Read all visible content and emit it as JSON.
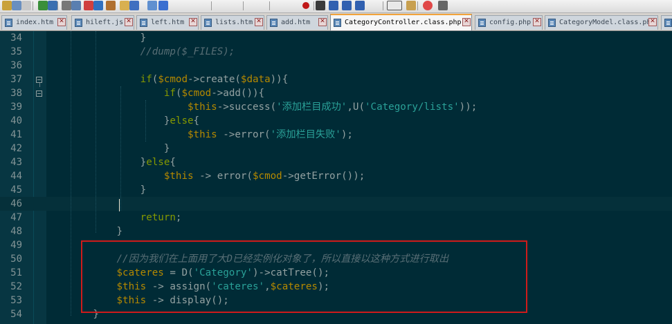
{
  "colors": {
    "background": "#002b36",
    "gutter": "#073642",
    "keyword": "#859900",
    "variable": "#b58900",
    "string": "#2aa198",
    "comment": "#586e75",
    "plain": "#93a1a1",
    "annotation_box": "#d01b1b",
    "active_tab_accent": "#f2a23a"
  },
  "toolbar": {
    "icons": [
      "cut-icon",
      "copy-icon",
      "paste-icon",
      "undo-icon",
      "redo-icon",
      "print-icon",
      "find-icon",
      "zoom-in-icon",
      "zoom-out-icon",
      "sync-icon",
      "new-file-icon",
      "wrap-icon",
      "indent-guide-icon",
      "show-all-icon",
      "record-macro-icon",
      "stop-macro-icon",
      "play-macro-icon",
      "run-macro-icon",
      "save-macro-icon",
      "ds-icon",
      "bookmark-icon",
      "heart-icon",
      "monitor-icon"
    ]
  },
  "tabs": [
    {
      "label": "index.htm",
      "close": "✕"
    },
    {
      "label": "hileft.js",
      "close": "✕"
    },
    {
      "label": "left.htm",
      "close": "✕"
    },
    {
      "label": "lists.htm",
      "close": "✕"
    },
    {
      "label": "add.htm",
      "close": "✕"
    },
    {
      "label": "CategoryController.class.php",
      "close": "✕",
      "active": true
    },
    {
      "label": "config.php",
      "close": "✕"
    },
    {
      "label": "CategoryModel.class.php",
      "close": "✕"
    }
  ],
  "editor": {
    "current_line": 46,
    "lines": [
      {
        "num": "34",
        "tokens": [
          {
            "t": "                }",
            "c": "plain"
          }
        ]
      },
      {
        "num": "35",
        "tokens": [
          {
            "t": "                //dump($_FILES);",
            "c": "cm"
          }
        ]
      },
      {
        "num": "36",
        "tokens": []
      },
      {
        "num": "37",
        "tokens": [
          {
            "t": "                ",
            "c": "plain"
          },
          {
            "t": "if",
            "c": "kw"
          },
          {
            "t": "(",
            "c": "plain"
          },
          {
            "t": "$cmod",
            "c": "var"
          },
          {
            "t": "->create(",
            "c": "plain"
          },
          {
            "t": "$data",
            "c": "var"
          },
          {
            "t": ")){",
            "c": "plain"
          }
        ]
      },
      {
        "num": "38",
        "tokens": [
          {
            "t": "                    ",
            "c": "plain"
          },
          {
            "t": "if",
            "c": "kw"
          },
          {
            "t": "(",
            "c": "plain"
          },
          {
            "t": "$cmod",
            "c": "var"
          },
          {
            "t": "->add()){",
            "c": "plain"
          }
        ]
      },
      {
        "num": "39",
        "tokens": [
          {
            "t": "                        ",
            "c": "plain"
          },
          {
            "t": "$this",
            "c": "var"
          },
          {
            "t": "->success(",
            "c": "plain"
          },
          {
            "t": "'添加栏目成功'",
            "c": "str"
          },
          {
            "t": ",U(",
            "c": "plain"
          },
          {
            "t": "'Category/lists'",
            "c": "str"
          },
          {
            "t": "));",
            "c": "plain"
          }
        ]
      },
      {
        "num": "40",
        "tokens": [
          {
            "t": "                    }",
            "c": "plain"
          },
          {
            "t": "else",
            "c": "kw"
          },
          {
            "t": "{",
            "c": "plain"
          }
        ]
      },
      {
        "num": "41",
        "tokens": [
          {
            "t": "                        ",
            "c": "plain"
          },
          {
            "t": "$this",
            "c": "var"
          },
          {
            "t": " ->error(",
            "c": "plain"
          },
          {
            "t": "'添加栏目失败'",
            "c": "str"
          },
          {
            "t": ");",
            "c": "plain"
          }
        ]
      },
      {
        "num": "42",
        "tokens": [
          {
            "t": "                    }",
            "c": "plain"
          }
        ]
      },
      {
        "num": "43",
        "tokens": [
          {
            "t": "                }",
            "c": "plain"
          },
          {
            "t": "else",
            "c": "kw"
          },
          {
            "t": "{",
            "c": "plain"
          }
        ]
      },
      {
        "num": "44",
        "tokens": [
          {
            "t": "                    ",
            "c": "plain"
          },
          {
            "t": "$this",
            "c": "var"
          },
          {
            "t": " -> error(",
            "c": "plain"
          },
          {
            "t": "$cmod",
            "c": "var"
          },
          {
            "t": "->getError());",
            "c": "plain"
          }
        ]
      },
      {
        "num": "45",
        "tokens": [
          {
            "t": "                }",
            "c": "plain"
          }
        ]
      },
      {
        "num": "46",
        "tokens": []
      },
      {
        "num": "47",
        "tokens": [
          {
            "t": "                ",
            "c": "plain"
          },
          {
            "t": "return",
            "c": "kw"
          },
          {
            "t": ";",
            "c": "plain"
          }
        ]
      },
      {
        "num": "48",
        "tokens": [
          {
            "t": "            }",
            "c": "plain"
          }
        ]
      },
      {
        "num": "49",
        "tokens": []
      },
      {
        "num": "50",
        "tokens": [
          {
            "t": "            //因为我们在上面用了大D已经实例化对象了，所以直接以这种方式进行取出",
            "c": "cm"
          }
        ]
      },
      {
        "num": "51",
        "tokens": [
          {
            "t": "            ",
            "c": "plain"
          },
          {
            "t": "$cateres",
            "c": "var"
          },
          {
            "t": " = D(",
            "c": "plain"
          },
          {
            "t": "'Category'",
            "c": "str"
          },
          {
            "t": ")->catTree();",
            "c": "plain"
          }
        ]
      },
      {
        "num": "52",
        "tokens": [
          {
            "t": "            ",
            "c": "plain"
          },
          {
            "t": "$this",
            "c": "var"
          },
          {
            "t": " -> assign(",
            "c": "plain"
          },
          {
            "t": "'cateres'",
            "c": "str"
          },
          {
            "t": ",",
            "c": "plain"
          },
          {
            "t": "$cateres",
            "c": "var"
          },
          {
            "t": ");",
            "c": "plain"
          }
        ]
      },
      {
        "num": "53",
        "tokens": [
          {
            "t": "            ",
            "c": "plain"
          },
          {
            "t": "$this",
            "c": "var"
          },
          {
            "t": " -> display();",
            "c": "plain"
          }
        ]
      },
      {
        "num": "54",
        "tokens": [
          {
            "t": "        }",
            "c": "plain"
          }
        ]
      }
    ]
  }
}
